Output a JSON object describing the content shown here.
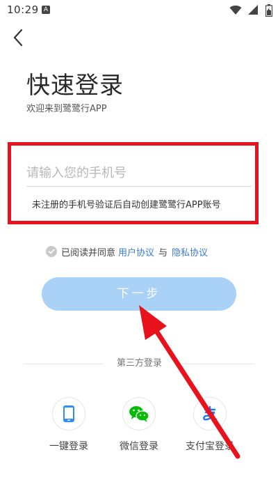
{
  "status_bar": {
    "time": "10:29",
    "notification_icon": "a-letter-icon",
    "icons": [
      "wifi-icon",
      "signal-icon",
      "battery-icon"
    ]
  },
  "header": {
    "back_icon": "chevron-left-icon"
  },
  "page": {
    "title": "快速登录",
    "subtitle": "欢迎来到鹭鹭行APP"
  },
  "phone_form": {
    "placeholder": "请输入您的手机号",
    "value": "",
    "hint": "未注册的手机号验证后自动创建鹭鹭行APP账号"
  },
  "agreement": {
    "prefix": "已阅读并同意",
    "user_agreement": "用户协议",
    "connector": "与",
    "privacy_agreement": "隐私协议",
    "checked": false
  },
  "next_button": {
    "label": "下一步"
  },
  "third_party": {
    "title": "第三方登录",
    "options": [
      {
        "label": "一键登录",
        "icon": "phone-icon"
      },
      {
        "label": "微信登录",
        "icon": "wechat-icon"
      },
      {
        "label": "支付宝登录",
        "icon": "alipay-icon"
      }
    ]
  },
  "colors": {
    "accent_blue": "#3a7bd5",
    "button_disabled": "#a9d2f6",
    "annotation_red": "#e8121c",
    "wechat_green": "#09bb07",
    "alipay_blue": "#1677ff"
  }
}
